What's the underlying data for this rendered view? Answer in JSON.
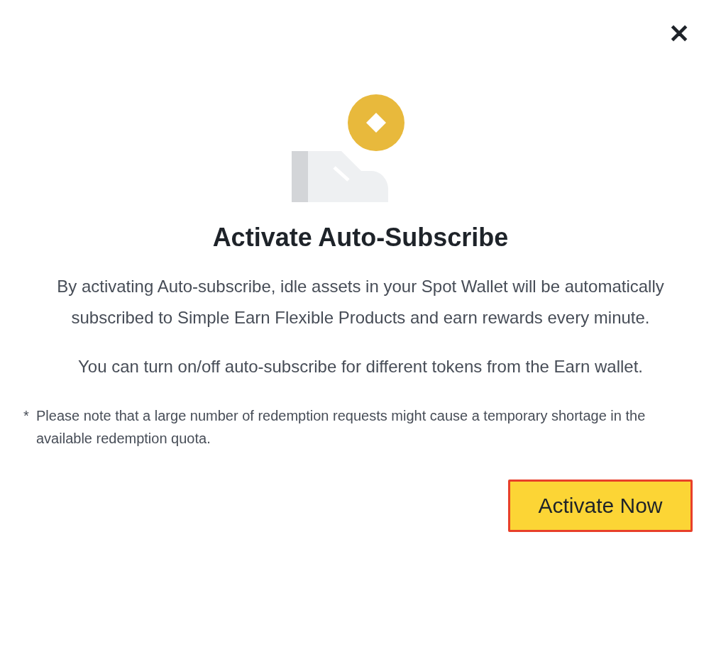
{
  "close": {
    "label": "✕"
  },
  "title": "Activate Auto-Subscribe",
  "paragraphs": [
    "By activating Auto-subscribe, idle assets in your Spot Wallet will be automatically subscribed to Simple Earn Flexible Products and earn rewards every minute.",
    "You can turn on/off auto-subscribe for different tokens from the Earn wallet."
  ],
  "note": {
    "marker": "*",
    "text": "Please note that a large number of redemption requests might cause a temporary shortage in the available redemption quota."
  },
  "button": {
    "label": "Activate Now",
    "highlighted": true
  }
}
